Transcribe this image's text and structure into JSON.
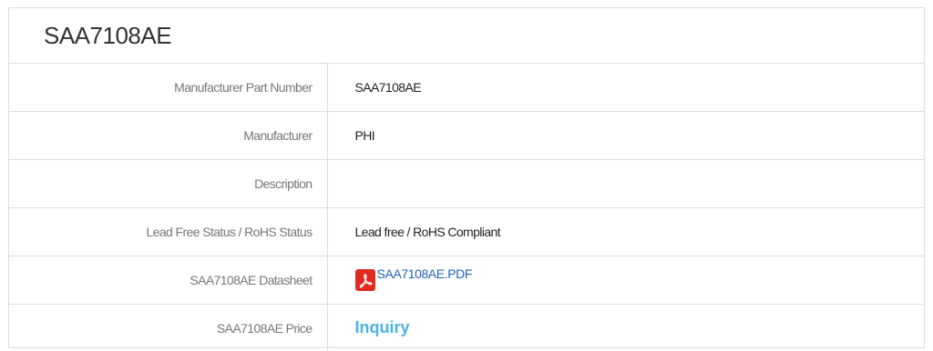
{
  "title": "SAA7108AE",
  "rows": [
    {
      "label": "Manufacturer Part Number",
      "value": "SAA7108AE"
    },
    {
      "label": "Manufacturer",
      "value": "PHI"
    },
    {
      "label": "Description",
      "value": ""
    },
    {
      "label": "Lead Free Status / RoHS Status",
      "value": "Lead free / RoHS Compliant"
    },
    {
      "label": "SAA7108AE Datasheet",
      "value": "SAA7108AE.PDF"
    },
    {
      "label": "SAA7108AE Price",
      "value": "Inquiry"
    }
  ],
  "icons": {
    "datasheet": "pdf-icon"
  },
  "colors": {
    "pdf_icon": "#e02b20",
    "link": "#1f64b8",
    "inquiry": "#4bb4e3",
    "border": "#dddddd"
  }
}
